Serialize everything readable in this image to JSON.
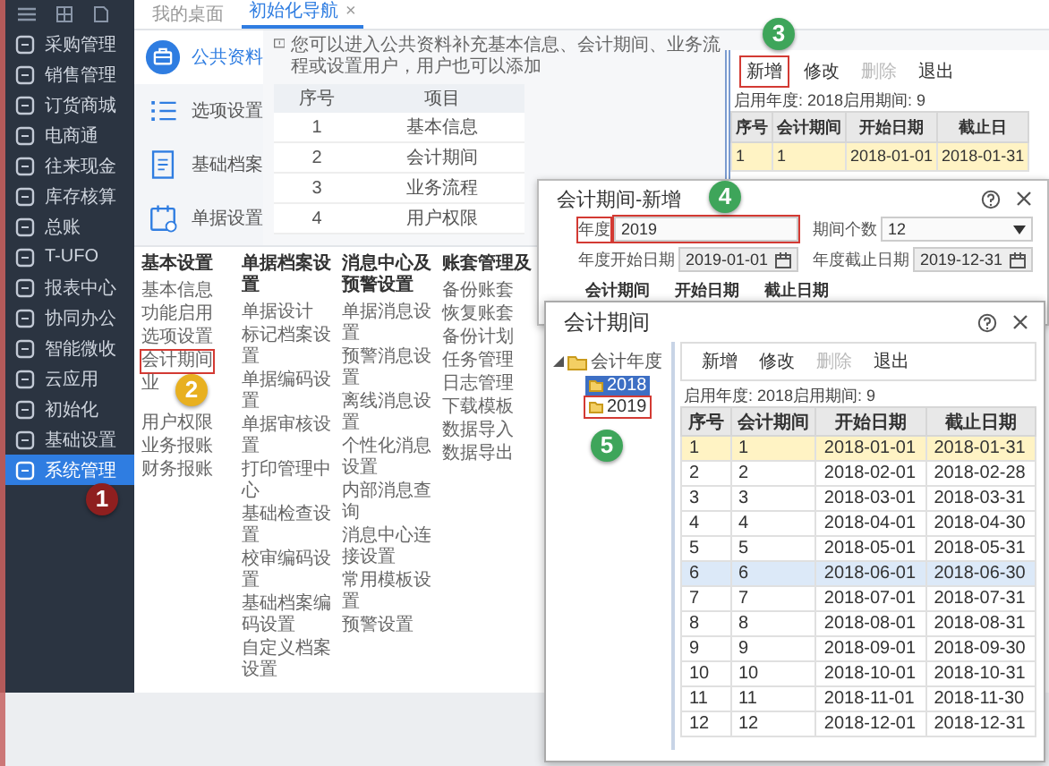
{
  "sidebar": {
    "items": [
      {
        "label": "采购管理",
        "selected": false
      },
      {
        "label": "销售管理",
        "selected": false
      },
      {
        "label": "订货商城",
        "selected": false
      },
      {
        "label": "电商通",
        "selected": false
      },
      {
        "label": "往来现金",
        "selected": false
      },
      {
        "label": "库存核算",
        "selected": false
      },
      {
        "label": "总账",
        "selected": false
      },
      {
        "label": "T-UFO",
        "selected": false
      },
      {
        "label": "报表中心",
        "selected": false
      },
      {
        "label": "协同办公",
        "selected": false
      },
      {
        "label": "智能微收",
        "selected": false
      },
      {
        "label": "云应用",
        "selected": false
      },
      {
        "label": "初始化",
        "selected": false
      },
      {
        "label": "基础设置",
        "selected": false
      },
      {
        "label": "系统管理",
        "selected": true
      }
    ]
  },
  "tabs": [
    {
      "label": "我的桌面",
      "selected": false
    },
    {
      "label": "初始化导航",
      "selected": true,
      "close": "×"
    }
  ],
  "notice": "您可以进入公共资料补充基本信息、会计期间、业务流程或设置用户，用户也可以添加",
  "nav": [
    {
      "label": "公共资料",
      "selected": true
    },
    {
      "label": "选项设置",
      "selected": false
    },
    {
      "label": "基础档案",
      "selected": false
    },
    {
      "label": "单据设置",
      "selected": false
    }
  ],
  "guide_table": {
    "columns": [
      "序号",
      "项目"
    ],
    "rows": [
      [
        "1",
        "基本信息"
      ],
      [
        "2",
        "会计期间"
      ],
      [
        "3",
        "业务流程"
      ],
      [
        "4",
        "用户权限"
      ]
    ]
  },
  "menu": {
    "columns": [
      {
        "title": "基本设置",
        "items": [
          {
            "label": "基本信息",
            "boxed": false
          },
          {
            "label": "功能启用",
            "boxed": false
          },
          {
            "label": "选项设置",
            "boxed": false
          },
          {
            "label": "会计期间",
            "boxed": true
          },
          {
            "label": "业",
            "boxed": false
          },
          {
            "label": "用户权限",
            "boxed": false
          },
          {
            "label": "业务报账",
            "boxed": false
          },
          {
            "label": "财务报账",
            "boxed": false
          }
        ]
      },
      {
        "title": "单据档案设置",
        "items": [
          {
            "label": "单据设计",
            "boxed": false
          },
          {
            "label": "标记档案设置",
            "boxed": false
          },
          {
            "label": "单据编码设置",
            "boxed": false
          },
          {
            "label": "单据审核设置",
            "boxed": false
          },
          {
            "label": "打印管理中心",
            "boxed": false
          },
          {
            "label": "基础检查设置",
            "boxed": false
          },
          {
            "label": "校审编码设置",
            "boxed": false
          },
          {
            "label": "基础档案编码设置",
            "boxed": false
          },
          {
            "label": "自定义档案设置",
            "boxed": false
          }
        ]
      },
      {
        "title": "消息中心及预警设置",
        "items": [
          {
            "label": "单据消息设置",
            "boxed": false
          },
          {
            "label": "预警消息设置",
            "boxed": false
          },
          {
            "label": "离线消息设置",
            "boxed": false
          },
          {
            "label": "个性化消息设置",
            "boxed": false
          },
          {
            "label": "内部消息查询",
            "boxed": false
          },
          {
            "label": "消息中心连接设置",
            "boxed": false
          },
          {
            "label": "常用模板设置",
            "boxed": false
          },
          {
            "label": "预警设置",
            "boxed": false
          }
        ]
      },
      {
        "title": "账套管理及",
        "items": [
          {
            "label": "备份账套",
            "boxed": false
          },
          {
            "label": "恢复账套",
            "boxed": false
          },
          {
            "label": "备份计划",
            "boxed": false
          },
          {
            "label": "任务管理",
            "boxed": false
          },
          {
            "label": "日志管理",
            "boxed": false
          },
          {
            "label": "下载模板",
            "boxed": false
          },
          {
            "label": "数据导入",
            "boxed": false
          },
          {
            "label": "数据导出",
            "boxed": false
          }
        ]
      }
    ]
  },
  "period_window": {
    "toolbar": [
      {
        "label": "新增",
        "disabled": false,
        "boxed": true
      },
      {
        "label": "修改",
        "disabled": false,
        "boxed": false
      },
      {
        "label": "删除",
        "disabled": true,
        "boxed": false
      },
      {
        "label": "退出",
        "disabled": false,
        "boxed": false
      }
    ],
    "info": "启用年度: 2018启用期间: 9",
    "columns": [
      "序号",
      "会计期间",
      "开始日期",
      "截止日"
    ],
    "rows": [
      {
        "cells": [
          "1",
          "1",
          "2018-01-01",
          "2018-01-31"
        ],
        "current": true,
        "selected": false
      }
    ]
  },
  "new_dialog": {
    "title": "会计期间-新增",
    "fields": [
      {
        "label": "年度",
        "value": "2019",
        "kind": "text",
        "boxed": true
      },
      {
        "label": "期间个数",
        "value": "12",
        "kind": "select",
        "boxed": false
      },
      {
        "label": "年度开始日期",
        "value": "2019-01-01",
        "kind": "date",
        "boxed": false
      },
      {
        "label": "年度截止日期",
        "value": "2019-12-31",
        "kind": "date",
        "boxed": false
      }
    ],
    "behind_columns": [
      "会计期间",
      "开始日期",
      "截止日期"
    ]
  },
  "period_dialog": {
    "title": "会计期间",
    "tree": {
      "label": "会计年度",
      "expanded": true,
      "children": [
        {
          "label": "2018",
          "selected": true,
          "boxed": false
        },
        {
          "label": "2019",
          "selected": false,
          "boxed": true
        }
      ]
    },
    "toolbar": [
      {
        "label": "新增",
        "disabled": false,
        "boxed": false
      },
      {
        "label": "修改",
        "disabled": false,
        "boxed": false
      },
      {
        "label": "删除",
        "disabled": true,
        "boxed": false
      },
      {
        "label": "退出",
        "disabled": false,
        "boxed": false
      }
    ],
    "info": "启用年度: 2018启用期间: 9",
    "columns": [
      "序号",
      "会计期间",
      "开始日期",
      "截止日期"
    ],
    "rows": [
      {
        "cells": [
          "1",
          "1",
          "2018-01-01",
          "2018-01-31"
        ],
        "current": true,
        "selected": false
      },
      {
        "cells": [
          "2",
          "2",
          "2018-02-01",
          "2018-02-28"
        ],
        "current": false,
        "selected": false
      },
      {
        "cells": [
          "3",
          "3",
          "2018-03-01",
          "2018-03-31"
        ],
        "current": false,
        "selected": false
      },
      {
        "cells": [
          "4",
          "4",
          "2018-04-01",
          "2018-04-30"
        ],
        "current": false,
        "selected": false
      },
      {
        "cells": [
          "5",
          "5",
          "2018-05-01",
          "2018-05-31"
        ],
        "current": false,
        "selected": false
      },
      {
        "cells": [
          "6",
          "6",
          "2018-06-01",
          "2018-06-30"
        ],
        "current": false,
        "selected": true
      },
      {
        "cells": [
          "7",
          "7",
          "2018-07-01",
          "2018-07-31"
        ],
        "current": false,
        "selected": false
      },
      {
        "cells": [
          "8",
          "8",
          "2018-08-01",
          "2018-08-31"
        ],
        "current": false,
        "selected": false
      },
      {
        "cells": [
          "9",
          "9",
          "2018-09-01",
          "2018-09-30"
        ],
        "current": false,
        "selected": false
      },
      {
        "cells": [
          "10",
          "10",
          "2018-10-01",
          "2018-10-31"
        ],
        "current": false,
        "selected": false
      },
      {
        "cells": [
          "11",
          "11",
          "2018-11-01",
          "2018-11-30"
        ],
        "current": false,
        "selected": false
      },
      {
        "cells": [
          "12",
          "12",
          "2018-12-01",
          "2018-12-31"
        ],
        "current": false,
        "selected": false
      }
    ]
  },
  "markers": [
    {
      "label": "1",
      "color": "#8e1f1f"
    },
    {
      "label": "2",
      "color": "#e8b020"
    },
    {
      "label": "3",
      "color": "#3ea55a"
    },
    {
      "label": "4",
      "color": "#3ea55a"
    },
    {
      "label": "5",
      "color": "#3ea55a"
    }
  ]
}
